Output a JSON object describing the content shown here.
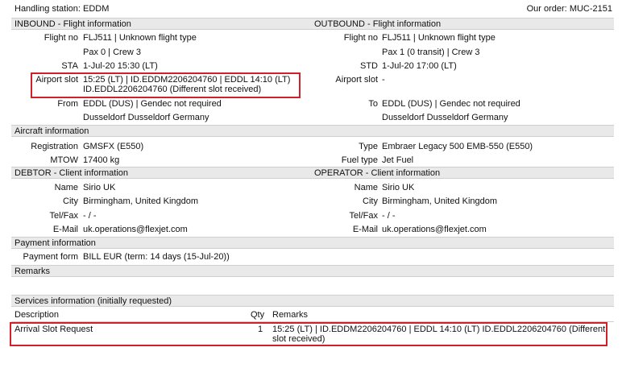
{
  "header": {
    "handling_label": "Handling station:",
    "handling_value": "EDDM",
    "order_label": "Our order:",
    "order_value": "MUC-2151"
  },
  "inbound": {
    "title_bold": "INBOUND",
    "title_rest": " - Flight information",
    "flight_no_label": "Flight no",
    "flight_no_value": "FLJ511 | Unknown flight type",
    "pax_value": "Pax 0 | Crew 3",
    "sta_label": "STA",
    "sta_value": "1-Jul-20 15:30 (LT)",
    "slot_label": "Airport slot",
    "slot_line1": "15:25 (LT) | ID.EDDM2206204760 | EDDL 14:10 (LT)",
    "slot_line2": "ID.EDDL2206204760 (Different slot received)",
    "from_label": "From",
    "from_value": "EDDL (DUS) | Gendec not required",
    "from_city": "Dusseldorf Dusseldorf Germany"
  },
  "outbound": {
    "title_bold": "OUTBOUND",
    "title_rest": " - Flight information",
    "flight_no_label": "Flight no",
    "flight_no_value": "FLJ511 | Unknown flight type",
    "pax_value": "Pax 1 (0 transit) | Crew 3",
    "std_label": "STD",
    "std_value": "1-Jul-20 17:00 (LT)",
    "slot_label": "Airport slot",
    "slot_value": "-",
    "to_label": "To",
    "to_value": "EDDL (DUS) | Gendec not required",
    "to_city": "Dusseldorf Dusseldorf Germany"
  },
  "aircraft": {
    "title": "Aircraft information",
    "registration_label": "Registration",
    "registration_value": "GMSFX (E550)",
    "mtow_label": "MTOW",
    "mtow_value": "17400 kg",
    "type_label": "Type",
    "type_value": "Embraer Legacy 500 EMB-550 (E550)",
    "fuel_label": "Fuel type",
    "fuel_value": "Jet Fuel"
  },
  "debtor": {
    "title_bold": "DEBTOR",
    "title_rest": " - Client information",
    "name_label": "Name",
    "name_value": "Sirio UK",
    "city_label": "City",
    "city_value": "Birmingham, United Kingdom",
    "tel_label": "Tel/Fax",
    "tel_value": "- / -",
    "email_label": "E-Mail",
    "email_value": "uk.operations@flexjet.com"
  },
  "operator": {
    "title_bold": "OPERATOR",
    "title_rest": " - Client information",
    "name_label": "Name",
    "name_value": "Sirio UK",
    "city_label": "City",
    "city_value": "Birmingham, United Kingdom",
    "tel_label": "Tel/Fax",
    "tel_value": "- / -",
    "email_label": "E-Mail",
    "email_value": "uk.operations@flexjet.com"
  },
  "payment": {
    "title": "Payment information",
    "form_label": "Payment form",
    "form_value": "BILL EUR (term: 14 days (15-Jul-20))"
  },
  "remarks": {
    "title": "Remarks"
  },
  "services": {
    "title": "Services information (initially requested)",
    "col_description": "Description",
    "col_qty": "Qty",
    "col_remarks": "Remarks",
    "row_description": "Arrival Slot Request",
    "row_qty": "1",
    "row_remarks_line1": "15:25 (LT) | ID.EDDM2206204760 | EDDL 14:10 (LT) ID.EDDL2206204760 (Different",
    "row_remarks_line2": "slot received)"
  },
  "colors": {
    "highlight_border": "#d0202a",
    "section_bg": "#e9e9e9"
  }
}
